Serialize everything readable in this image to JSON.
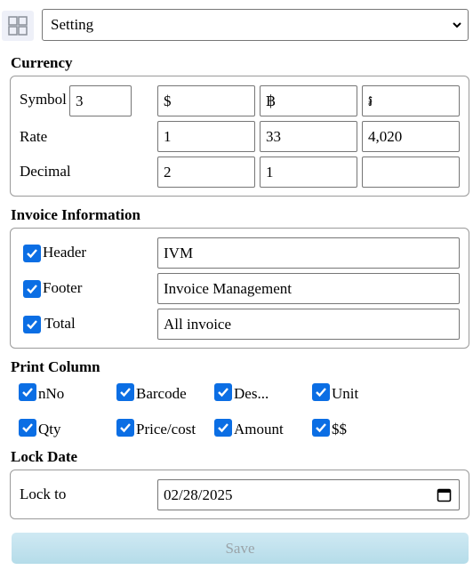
{
  "settings_select": {
    "value": "Setting"
  },
  "currency": {
    "title": "Currency",
    "symbol_label": "Symbol",
    "symbol_count": "3",
    "symbols": [
      "$",
      "฿",
      "៛"
    ],
    "rate_label": "Rate",
    "rates": [
      "1",
      "33",
      "4,020"
    ],
    "decimal_label": "Decimal",
    "decimals": [
      "2",
      "1",
      ""
    ]
  },
  "invoice": {
    "title": "Invoice Information",
    "header_label": "Header",
    "header_value": "IVM",
    "footer_label": "Footer",
    "footer_value": "Invoice Management",
    "total_label": "Total",
    "total_value": "All invoice"
  },
  "print_column": {
    "title": "Print Column",
    "columns": [
      "nNo",
      "Barcode",
      "Des...",
      "Unit",
      "Qty",
      "Price/cost",
      "Amount",
      "$$"
    ]
  },
  "lock_date": {
    "title": "Lock Date",
    "lock_to_label": "Lock to",
    "date_value": "02/28/2025"
  },
  "save_label": "Save",
  "colors": {
    "checkbox": "#0b6ee4",
    "save_bg": "#c3e3ee"
  }
}
